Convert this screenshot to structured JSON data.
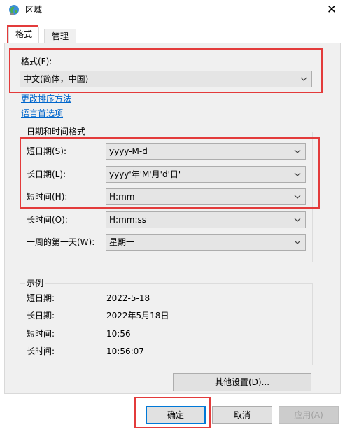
{
  "window": {
    "title": "区域",
    "close_glyph": "✕"
  },
  "tabs": [
    {
      "label": "格式",
      "selected": true
    },
    {
      "label": "管理",
      "selected": false
    }
  ],
  "format": {
    "label": "格式(F):",
    "value": "中文(简体，中国)",
    "link_sort": "更改排序方法",
    "link_lang": "语言首选项"
  },
  "datetime": {
    "group_title": "日期和时间格式",
    "rows": [
      {
        "label": "短日期(S):",
        "value": "yyyy-M-d"
      },
      {
        "label": "长日期(L):",
        "value": "yyyy'年'M'月'd'日'"
      },
      {
        "label": "短时间(H):",
        "value": "H:mm"
      },
      {
        "label": "长时间(O):",
        "value": "H:mm:ss"
      },
      {
        "label": "一周的第一天(W):",
        "value": "星期一"
      }
    ]
  },
  "examples": {
    "group_title": "示例",
    "rows": [
      {
        "label": "短日期:",
        "value": "2022-5-18"
      },
      {
        "label": "长日期:",
        "value": "2022年5月18日"
      },
      {
        "label": "短时间:",
        "value": "10:56"
      },
      {
        "label": "长时间:",
        "value": "10:56:07"
      }
    ]
  },
  "buttons": {
    "other_settings": "其他设置(D)...",
    "ok": "确定",
    "cancel": "取消",
    "apply": "应用(A)"
  },
  "colors": {
    "highlight": "#e33b3b",
    "link": "#0066cc",
    "accent": "#0078d7"
  }
}
